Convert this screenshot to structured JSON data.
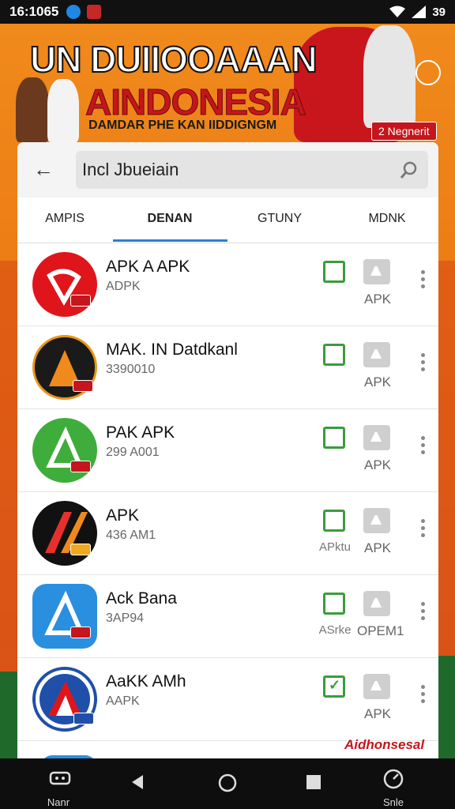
{
  "status_bar": {
    "time": "16:1065",
    "right_text": "39"
  },
  "banner": {
    "title_line1": "UN DUIIOOAAAN",
    "title_line2": "AINDONESIA",
    "subtitle": "DAMDAR PHE KAN IIDDIGNGM",
    "badge": "2 Negnerit"
  },
  "search": {
    "query": "Incl Jbueiain"
  },
  "tabs": [
    {
      "label": "AMPIS"
    },
    {
      "label": "DENAN"
    },
    {
      "label": "GTUNY"
    },
    {
      "label": "MDNK"
    }
  ],
  "active_tab": "DENAN",
  "apps": [
    {
      "name": "APK A APK",
      "sub": "ADPK",
      "check_label": "",
      "right_label": "APK",
      "checked": false,
      "icon_color": "#e0151b"
    },
    {
      "name": "MAK. IN Datdkanl",
      "sub": "3390010",
      "check_label": "",
      "right_label": "APK",
      "checked": false,
      "icon_color": "#1a1a1a"
    },
    {
      "name": "PAK APK",
      "sub": "299 A001",
      "check_label": "",
      "right_label": "APK",
      "checked": false,
      "icon_color": "#3fad3b"
    },
    {
      "name": "APK",
      "sub": "436 AM1",
      "check_label": "APktu",
      "right_label": "APK",
      "checked": false,
      "icon_color": "#111111"
    },
    {
      "name": "Ack Bana",
      "sub": "3AP94",
      "check_label": "ASrke",
      "right_label": "OPEM1",
      "checked": false,
      "icon_color": "#2b8fe0"
    },
    {
      "name": "AaKK AMh",
      "sub": "AAPK",
      "check_label": "",
      "right_label": "APK",
      "checked": true,
      "icon_color": "#1f4fa8"
    }
  ],
  "watermark": "Aidhonsesal",
  "nav": {
    "left_label": "Nanr",
    "right_label": "Snle"
  }
}
